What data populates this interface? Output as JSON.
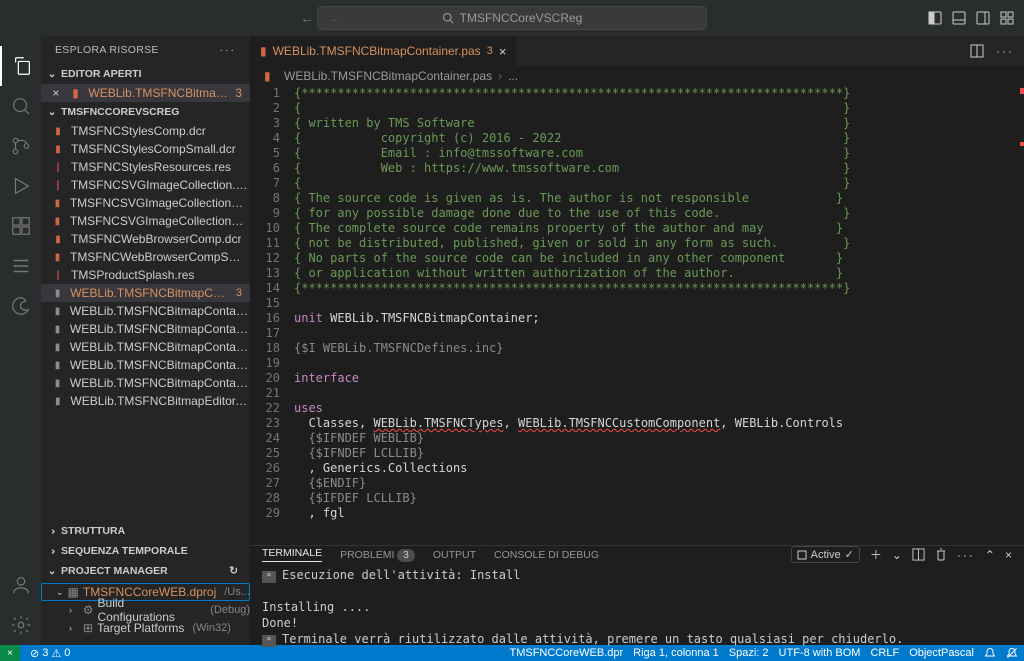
{
  "titlebar": {
    "search_placeholder": "TMSFNCCoreVSCReg"
  },
  "sidebar": {
    "title": "ESPLORA RISORSE",
    "sections": {
      "openEditors": "EDITOR APERTI",
      "workspace": "TMSFNCCOREVSCREG",
      "outline": "STRUTTURA",
      "timeline": "SEQUENZA TEMPORALE",
      "projectManager": "PROJECT MANAGER"
    },
    "openEditor": {
      "label": "WEBLib.TMSFNCBitmap...",
      "badge": "3"
    },
    "files": [
      {
        "label": "TMSFNCStylesComp.dcr",
        "icon": "orange"
      },
      {
        "label": "TMSFNCStylesCompSmall.dcr",
        "icon": "orange"
      },
      {
        "label": "TMSFNCStylesResources.res",
        "icon": "red"
      },
      {
        "label": "TMSFNCSVGImageCollection.res",
        "icon": "red"
      },
      {
        "label": "TMSFNCSVGImageCollectionCom...",
        "icon": "orange"
      },
      {
        "label": "TMSFNCSVGImageCollectionCom...",
        "icon": "orange"
      },
      {
        "label": "TMSFNCWebBrowserComp.dcr",
        "icon": "orange"
      },
      {
        "label": "TMSFNCWebBrowserCompSmall....",
        "icon": "orange"
      },
      {
        "label": "TMSProductSplash.res",
        "icon": "red"
      },
      {
        "label": "WEBLib.TMSFNCBitmapCont...",
        "icon": "gray",
        "dirty": true,
        "badge": "3",
        "active": true
      },
      {
        "label": "WEBLib.TMSFNCBitmapContainer...",
        "icon": "gray"
      },
      {
        "label": "WEBLib.TMSFNCBitmapContainer...",
        "icon": "gray"
      },
      {
        "label": "WEBLib.TMSFNCBitmapContainer...",
        "icon": "gray"
      },
      {
        "label": "WEBLib.TMSFNCBitmapContainer...",
        "icon": "gray"
      },
      {
        "label": "WEBLib.TMSFNCBitmapContainer...",
        "icon": "gray"
      },
      {
        "label": "WEBLib.TMSFNCBitmapEditor.pas",
        "icon": "gray"
      }
    ],
    "project": {
      "name": "TMSFNCCoreWEB.dproj",
      "path": "/Us...",
      "children": [
        {
          "label": "Build Configurations",
          "sub": "(Debug)"
        },
        {
          "label": "Target Platforms",
          "sub": "(Win32)"
        }
      ]
    }
  },
  "editor": {
    "tab": {
      "name": "WEBLib.TMSFNCBitmapContainer.pas",
      "badge": "3"
    },
    "breadcrumb": "WEBLib.TMSFNCBitmapContainer.pas",
    "breadcrumb_rest": "..."
  },
  "code_lines": [
    {
      "n": 1,
      "cls": "c-comment",
      "t": "{***************************************************************************}"
    },
    {
      "n": 2,
      "cls": "c-comment",
      "t": "{                                                                           }"
    },
    {
      "n": 3,
      "cls": "c-comment",
      "t": "{ written by TMS Software                                                   }"
    },
    {
      "n": 4,
      "cls": "c-comment",
      "t": "{           copyright (c) 2016 - 2022                                       }"
    },
    {
      "n": 5,
      "cls": "c-comment",
      "t": "{           Email : info@tmssoftware.com                                    }"
    },
    {
      "n": 6,
      "cls": "c-comment",
      "t": "{           Web : https://www.tmssoftware.com                               }"
    },
    {
      "n": 7,
      "cls": "c-comment",
      "t": "{                                                                           }"
    },
    {
      "n": 8,
      "cls": "c-comment",
      "t": "{ The source code is given as is. The author is not responsible            }"
    },
    {
      "n": 9,
      "cls": "c-comment",
      "t": "{ for any possible damage done due to the use of this code.                 }"
    },
    {
      "n": 10,
      "cls": "c-comment",
      "t": "{ The complete source code remains property of the author and may          }"
    },
    {
      "n": 11,
      "cls": "c-comment",
      "t": "{ not be distributed, published, given or sold in any form as such.         }"
    },
    {
      "n": 12,
      "cls": "c-comment",
      "t": "{ No parts of the source code can be included in any other component       }"
    },
    {
      "n": 13,
      "cls": "c-comment",
      "t": "{ or application without written authorization of the author.              }"
    },
    {
      "n": 14,
      "cls": "c-comment",
      "t": "{***************************************************************************}"
    },
    {
      "n": 15,
      "cls": "",
      "t": ""
    },
    {
      "n": 16,
      "cls": "",
      "html": "<span class='c-keyword'>unit</span> <span class='c-id'>WEBLib.TMSFNCBitmapContainer;</span>"
    },
    {
      "n": 17,
      "cls": "",
      "t": ""
    },
    {
      "n": 18,
      "cls": "c-string",
      "t": "{$I WEBLib.TMSFNCDefines.inc}"
    },
    {
      "n": 19,
      "cls": "",
      "t": ""
    },
    {
      "n": 20,
      "cls": "c-keyword",
      "t": "interface"
    },
    {
      "n": 21,
      "cls": "",
      "t": ""
    },
    {
      "n": 22,
      "cls": "c-keyword",
      "t": "uses"
    },
    {
      "n": 23,
      "cls": "",
      "html": "  <span class='c-id'>Classes,</span> <span class='c-id c-err'>WEBLib.TMSFNCTypes</span><span class='c-id'>,</span> <span class='c-id c-err'>WEBLib.TMSFNCCustomComponent</span><span class='c-id'>, WEBLib.Controls</span>"
    },
    {
      "n": 24,
      "cls": "c-string",
      "t": "  {$IFNDEF WEBLIB}"
    },
    {
      "n": 25,
      "cls": "c-string",
      "t": "  {$IFNDEF LCLLIB}"
    },
    {
      "n": 26,
      "cls": "c-id",
      "t": "  , Generics.Collections"
    },
    {
      "n": 27,
      "cls": "c-string",
      "t": "  {$ENDIF}"
    },
    {
      "n": 28,
      "cls": "c-string",
      "t": "  {$IFDEF LCLLIB}"
    },
    {
      "n": 29,
      "cls": "c-id",
      "t": "  , fgl"
    }
  ],
  "panel": {
    "tabs": {
      "terminal": "TERMINALE",
      "problems": "PROBLEMI",
      "problems_count": "3",
      "output": "OUTPUT",
      "debug": "CONSOLE DI DEBUG"
    },
    "active_label": "Active",
    "terminal_lines": [
      {
        "marker": true,
        "t": "Esecuzione dell'attività: Install"
      },
      {
        "blank": true
      },
      {
        "t": "Installing ...."
      },
      {
        "t": "Done!"
      },
      {
        "marker": true,
        "t": "Terminale verrà riutilizzato dalle attività, premere un tasto qualsiasi per chiuderlo."
      }
    ]
  },
  "statusbar": {
    "errors": "3",
    "warnings": "0",
    "project": "TMSFNCCoreWEB.dpr",
    "cursor": "Riga 1, colonna 1",
    "spaces": "Spazi: 2",
    "encoding": "UTF-8 with BOM",
    "eol": "CRLF",
    "lang": "ObjectPascal"
  }
}
